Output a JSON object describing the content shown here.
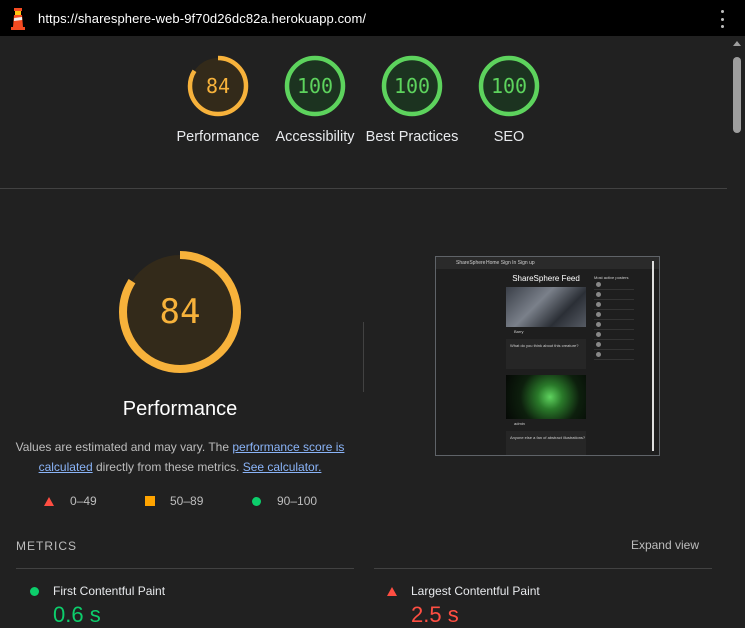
{
  "topbar": {
    "url": "https://sharesphere-web-9f70d26dc82a.herokuapp.com/"
  },
  "scores": [
    {
      "label": "Performance",
      "value": "84",
      "fraction": 0.84,
      "color": "#f7b23b",
      "bg": "#332a1a"
    },
    {
      "label": "Accessibility",
      "value": "100",
      "fraction": 1.0,
      "color": "#5dd35d",
      "bg": "#1c3320"
    },
    {
      "label": "Best Practices",
      "value": "100",
      "fraction": 1.0,
      "color": "#5dd35d",
      "bg": "#1c3320"
    },
    {
      "label": "SEO",
      "value": "100",
      "fraction": 1.0,
      "color": "#5dd35d",
      "bg": "#1c3320"
    }
  ],
  "performance": {
    "score": "84",
    "title": "Performance",
    "desc_prefix": "Values are estimated and may vary. The ",
    "desc_link1": "performance score is calculated",
    "desc_middle": " directly from these metrics. ",
    "desc_link2": "See calculator."
  },
  "legend": [
    {
      "icon": "triangle-icon",
      "label": "0–49",
      "color": "#ff4e42"
    },
    {
      "icon": "square-icon",
      "label": "50–89",
      "color": "#ffa400"
    },
    {
      "icon": "circle-icon",
      "label": "90–100",
      "color": "#0cce6b"
    }
  ],
  "screenshot": {
    "nav_brand": "ShareSphere",
    "nav_links": "Home   Sign In   Sign up",
    "feed_title": "ShareSphere Feed",
    "sidebar_title": "Most active posters",
    "post1_user": "Barry",
    "post1_question": "What do you think about this creature?",
    "post2_user": "admin",
    "post2_question": "Anyone else a fan of abstract illustrations?"
  },
  "metrics": {
    "header": "METRICS",
    "expand_label": "Expand view",
    "items": [
      {
        "name": "First Contentful Paint",
        "value": "0.6 s",
        "color": "#0cce6b",
        "icon": "circle-icon"
      },
      {
        "name": "Largest Contentful Paint",
        "value": "2.5 s",
        "color": "#ff4e42",
        "icon": "triangle-icon"
      }
    ]
  }
}
